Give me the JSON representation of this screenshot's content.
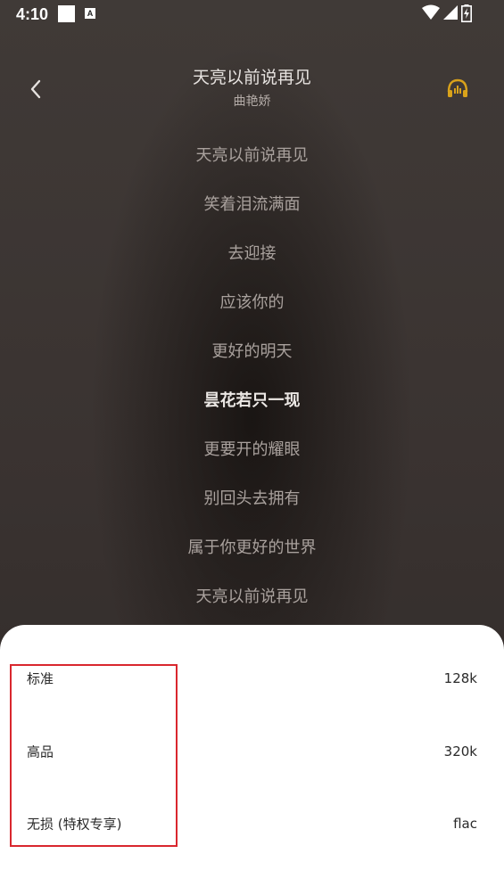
{
  "status_bar": {
    "time": "4:10",
    "badge_letter": "A",
    "icons": [
      "wifi-icon",
      "cell-signal-icon",
      "battery-charging-icon"
    ]
  },
  "header": {
    "title": "天亮以前说再见",
    "artist": "曲艳娇",
    "back_icon": "chevron-left-icon",
    "audio_icon": "headphones-icon",
    "accent_color": "#d9a21b"
  },
  "lyrics": {
    "lines": [
      "天亮以前说再见",
      "笑着泪流满面",
      "去迎接",
      "应该你的",
      "更好的明天",
      "昙花若只一现",
      "更要开的耀眼",
      "别回头去拥有",
      "属于你更好的世界",
      "天亮以前说再见"
    ],
    "active_index": 5
  },
  "quality_sheet": {
    "options": [
      {
        "label": "标准",
        "rate": "128k"
      },
      {
        "label": "高品",
        "rate": "320k"
      },
      {
        "label": "无损 (特权专享)",
        "rate": "flac"
      }
    ],
    "highlight_color": "#d9272e"
  }
}
